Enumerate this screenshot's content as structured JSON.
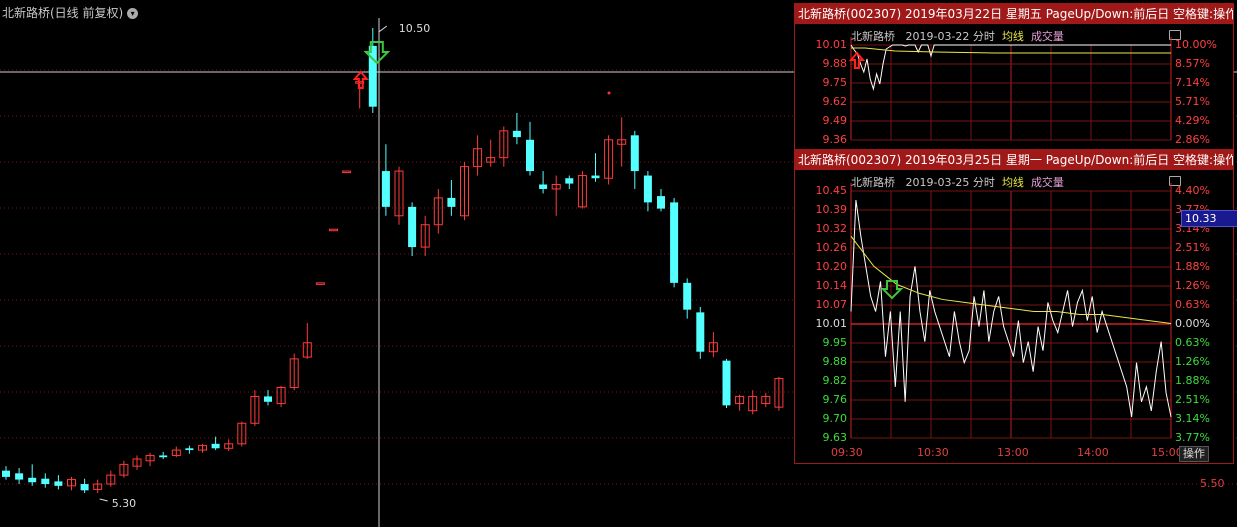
{
  "window_title": "北新路桥(日线 前复权)",
  "main_chart": {
    "high_label": "10.50",
    "low_label": "5.30",
    "right_axis_label": "5.50",
    "colors": {
      "up": "#ff3b3b",
      "down": "#54ffff",
      "grid": "#7a1515",
      "crosshair": "#cfcfcf"
    },
    "candles": [
      {
        "o": 5.55,
        "c": 5.48,
        "h": 5.6,
        "l": 5.45
      },
      {
        "o": 5.52,
        "c": 5.45,
        "h": 5.58,
        "l": 5.4
      },
      {
        "o": 5.47,
        "c": 5.42,
        "h": 5.62,
        "l": 5.38
      },
      {
        "o": 5.46,
        "c": 5.4,
        "h": 5.52,
        "l": 5.36
      },
      {
        "o": 5.43,
        "c": 5.38,
        "h": 5.5,
        "l": 5.34
      },
      {
        "o": 5.38,
        "c": 5.45,
        "h": 5.48,
        "l": 5.33
      },
      {
        "o": 5.4,
        "c": 5.33,
        "h": 5.46,
        "l": 5.3
      },
      {
        "o": 5.34,
        "c": 5.4,
        "h": 5.45,
        "l": 5.3
      },
      {
        "o": 5.4,
        "c": 5.5,
        "h": 5.55,
        "l": 5.37
      },
      {
        "o": 5.5,
        "c": 5.62,
        "h": 5.66,
        "l": 5.47
      },
      {
        "o": 5.6,
        "c": 5.68,
        "h": 5.72,
        "l": 5.56
      },
      {
        "o": 5.66,
        "c": 5.72,
        "h": 5.75,
        "l": 5.6
      },
      {
        "o": 5.72,
        "c": 5.7,
        "h": 5.76,
        "l": 5.68
      },
      {
        "o": 5.72,
        "c": 5.78,
        "h": 5.82,
        "l": 5.7
      },
      {
        "o": 5.8,
        "c": 5.78,
        "h": 5.83,
        "l": 5.74
      },
      {
        "o": 5.78,
        "c": 5.83,
        "h": 5.85,
        "l": 5.75
      },
      {
        "o": 5.85,
        "c": 5.8,
        "h": 5.93,
        "l": 5.78
      },
      {
        "o": 5.8,
        "c": 5.85,
        "h": 5.9,
        "l": 5.77
      },
      {
        "o": 5.85,
        "c": 6.08,
        "h": 6.1,
        "l": 5.82
      },
      {
        "o": 6.08,
        "c": 6.38,
        "h": 6.45,
        "l": 6.05
      },
      {
        "o": 6.38,
        "c": 6.32,
        "h": 6.45,
        "l": 6.28
      },
      {
        "o": 6.3,
        "c": 6.48,
        "h": 6.5,
        "l": 6.26
      },
      {
        "o": 6.48,
        "c": 6.8,
        "h": 6.86,
        "l": 6.45
      },
      {
        "o": 6.82,
        "c": 6.98,
        "h": 7.2,
        "l": 6.8
      },
      {
        "o": 7.65,
        "c": 7.65,
        "h": 7.65,
        "l": 7.65
      },
      {
        "o": 8.25,
        "c": 8.25,
        "h": 8.25,
        "l": 8.25
      },
      {
        "o": 8.9,
        "c": 8.9,
        "h": 8.9,
        "l": 8.9
      },
      {
        "o": 9.9,
        "c": 9.9,
        "h": 9.9,
        "l": 9.6
      },
      {
        "o": 10.3,
        "c": 9.62,
        "h": 10.5,
        "l": 9.55
      },
      {
        "o": 8.9,
        "c": 8.5,
        "h": 9.2,
        "l": 8.4
      },
      {
        "o": 8.4,
        "c": 8.9,
        "h": 8.95,
        "l": 8.3
      },
      {
        "o": 8.5,
        "c": 8.05,
        "h": 8.55,
        "l": 7.95
      },
      {
        "o": 8.05,
        "c": 8.3,
        "h": 8.4,
        "l": 7.95
      },
      {
        "o": 8.3,
        "c": 8.6,
        "h": 8.7,
        "l": 8.2
      },
      {
        "o": 8.6,
        "c": 8.5,
        "h": 8.8,
        "l": 8.4
      },
      {
        "o": 8.4,
        "c": 8.95,
        "h": 9.0,
        "l": 8.35
      },
      {
        "o": 8.95,
        "c": 9.15,
        "h": 9.3,
        "l": 8.85
      },
      {
        "o": 9.0,
        "c": 9.05,
        "h": 9.25,
        "l": 8.95
      },
      {
        "o": 9.05,
        "c": 9.35,
        "h": 9.4,
        "l": 8.95
      },
      {
        "o": 9.35,
        "c": 9.28,
        "h": 9.55,
        "l": 9.2
      },
      {
        "o": 9.25,
        "c": 8.9,
        "h": 9.45,
        "l": 8.85
      },
      {
        "o": 8.75,
        "c": 8.7,
        "h": 8.9,
        "l": 8.65
      },
      {
        "o": 8.7,
        "c": 8.75,
        "h": 8.85,
        "l": 8.4
      },
      {
        "o": 8.82,
        "c": 8.76,
        "h": 8.85,
        "l": 8.7
      },
      {
        "o": 8.5,
        "c": 8.85,
        "h": 8.9,
        "l": 8.48
      },
      {
        "o": 8.85,
        "c": 8.82,
        "h": 9.1,
        "l": 8.78
      },
      {
        "o": 8.82,
        "c": 9.25,
        "h": 9.3,
        "l": 8.75
      },
      {
        "o": 9.2,
        "c": 9.25,
        "h": 9.5,
        "l": 8.95
      },
      {
        "o": 9.3,
        "c": 8.9,
        "h": 9.35,
        "l": 8.7
      },
      {
        "o": 8.85,
        "c": 8.55,
        "h": 8.9,
        "l": 8.45
      },
      {
        "o": 8.62,
        "c": 8.48,
        "h": 8.7,
        "l": 8.45
      },
      {
        "o": 8.55,
        "c": 7.65,
        "h": 8.6,
        "l": 7.6
      },
      {
        "o": 7.65,
        "c": 7.35,
        "h": 7.7,
        "l": 7.25
      },
      {
        "o": 7.32,
        "c": 6.88,
        "h": 7.38,
        "l": 6.8
      },
      {
        "o": 6.88,
        "c": 6.98,
        "h": 7.1,
        "l": 6.82
      },
      {
        "o": 6.78,
        "c": 6.28,
        "h": 6.8,
        "l": 6.25
      },
      {
        "o": 6.3,
        "c": 6.38,
        "h": 6.4,
        "l": 6.22
      },
      {
        "o": 6.22,
        "c": 6.38,
        "h": 6.45,
        "l": 6.18
      },
      {
        "o": 6.3,
        "c": 6.38,
        "h": 6.42,
        "l": 6.26
      },
      {
        "o": 6.26,
        "c": 6.58,
        "h": 6.6,
        "l": 6.22
      }
    ],
    "selected_index": 28
  },
  "popup1": {
    "title": "北新路桥(002307) 2019年03月22日 星期五 PageUp/Down:前后日 空格键:操作",
    "stock_name": "北新路桥",
    "date_label": "2019-03-22 分时",
    "avg_label": "均线",
    "volume_label": "成交量",
    "left_prices": [
      "10.01",
      "9.88",
      "9.75",
      "9.62",
      "9.49",
      "9.36"
    ],
    "right_pcts": [
      "10.00%",
      "8.57%",
      "7.14%",
      "5.71%",
      "4.29%",
      "2.86%"
    ]
  },
  "popup2": {
    "title": "北新路桥(002307) 2019年03月25日 星期一 PageUp/Down:前后日 空格键:操作",
    "stock_name": "北新路桥",
    "date_label": "2019-03-25 分时",
    "avg_label": "均线",
    "volume_label": "成交量",
    "left_prices": [
      "10.45",
      "10.39",
      "10.32",
      "10.26",
      "10.20",
      "10.14",
      "10.07",
      "10.01",
      "9.95",
      "9.88",
      "9.82",
      "9.76",
      "9.70",
      "9.63"
    ],
    "right_pcts": [
      "4.40%",
      "3.77%",
      "3.14%",
      "2.51%",
      "1.88%",
      "1.26%",
      "0.63%",
      "0.00%",
      "0.63%",
      "1.26%",
      "1.88%",
      "2.51%",
      "3.14%",
      "3.77%"
    ],
    "time_labels": [
      "09:30",
      "10:30",
      "13:00",
      "14:00",
      "15:00"
    ],
    "current_price": "10.33",
    "op_button": "操作"
  }
}
